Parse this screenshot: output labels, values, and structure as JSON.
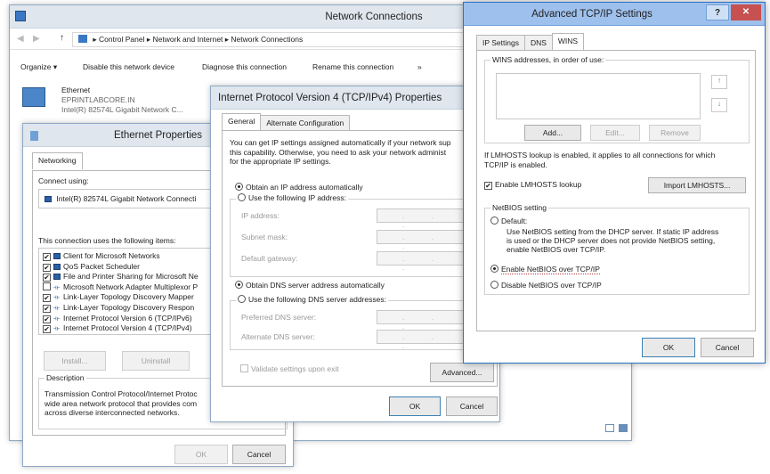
{
  "network_connections": {
    "title": "Network Connections",
    "breadcrumb": [
      "Control Panel",
      "Network and Internet",
      "Network Connections"
    ],
    "toolbar": [
      "Organize ▾",
      "Disable this network device",
      "Diagnose this connection",
      "Rename this connection",
      "»"
    ],
    "adapter": {
      "name": "Ethernet",
      "domain": "EPRINTLABCORE.IN",
      "device": "Intel(R) 82574L Gigabit Network C..."
    }
  },
  "ethernet_properties": {
    "title": "Ethernet Properties",
    "tab": "Networking",
    "connect_using_label": "Connect using:",
    "adapter": "Intel(R) 82574L Gigabit Network Connecti",
    "items_label": "This connection uses the following items:",
    "items": [
      {
        "label": "Client for Microsoft Networks",
        "checked": "✔",
        "icon": "computer-icon"
      },
      {
        "label": "QoS Packet Scheduler",
        "checked": "✔",
        "icon": "computer-icon"
      },
      {
        "label": "File and Printer Sharing for Microsoft Ne",
        "checked": "✔",
        "icon": "computer-icon"
      },
      {
        "label": "Microsoft Network Adapter Multiplexor P",
        "checked": "",
        "icon": "protocol-icon"
      },
      {
        "label": "Link-Layer Topology Discovery Mapper",
        "checked": "✔",
        "icon": "protocol-icon"
      },
      {
        "label": "Link-Layer Topology Discovery Respon",
        "checked": "✔",
        "icon": "protocol-icon"
      },
      {
        "label": "Internet Protocol Version 6 (TCP/IPv6)",
        "checked": "✔",
        "icon": "protocol-icon"
      },
      {
        "label": "Internet Protocol Version 4 (TCP/IPv4)",
        "checked": "✔",
        "icon": "protocol-icon"
      }
    ],
    "install_label": "Install...",
    "uninstall_label": "Uninstall",
    "description_label": "Description",
    "description_text": "Transmission Control Protocol/Internet Protoc\nwide area network protocol that provides com\nacross diverse interconnected networks.",
    "ok_label": "OK",
    "cancel_label": "Cancel"
  },
  "ipv4": {
    "title": "Internet Protocol Version 4 (TCP/IPv4) Properties",
    "tabs": [
      "General",
      "Alternate Configuration"
    ],
    "intro": "You can get IP settings assigned automatically if your network sup\nthis capability. Otherwise, you need to ask your network administ\nfor the appropriate IP settings.",
    "obtain_ip_auto": "Obtain an IP address automatically",
    "use_following_ip": "Use the following IP address:",
    "ip_address_label": "IP address:",
    "subnet_label": "Subnet mask:",
    "gateway_label": "Default gateway:",
    "obtain_dns_auto": "Obtain DNS server address automatically",
    "use_following_dns": "Use the following DNS server addresses:",
    "preferred_dns_label": "Preferred DNS server:",
    "alternate_dns_label": "Alternate DNS server:",
    "validate_label": "Validate settings upon exit",
    "advanced_label": "Advanced...",
    "ok_label": "OK",
    "cancel_label": "Cancel",
    "ip_dots": ". . ."
  },
  "advanced": {
    "title": "Advanced TCP/IP Settings",
    "help_label": "?",
    "close_label": "✕",
    "tabs": [
      "IP Settings",
      "DNS",
      "WINS"
    ],
    "wins_label": "WINS addresses, in order of use:",
    "add_label": "Add...",
    "edit_label": "Edit...",
    "remove_label": "Remove",
    "lmhosts_info": "If LMHOSTS lookup is enabled, it applies to all connections for which\nTCP/IP is enabled.",
    "enable_lmhosts": "Enable LMHOSTS lookup",
    "import_lmhosts": "Import LMHOSTS...",
    "netbios_group": "NetBIOS setting",
    "default_label": "Default:",
    "default_desc": "Use NetBIOS setting from the DHCP server. If static IP address\nis used or the DHCP server does not provide NetBIOS setting,\nenable NetBIOS over TCP/IP.",
    "enable_netbios": "Enable NetBIOS over TCP/IP",
    "disable_netbios": "Disable NetBIOS over TCP/IP",
    "ok_label": "OK",
    "cancel_label": "Cancel"
  }
}
